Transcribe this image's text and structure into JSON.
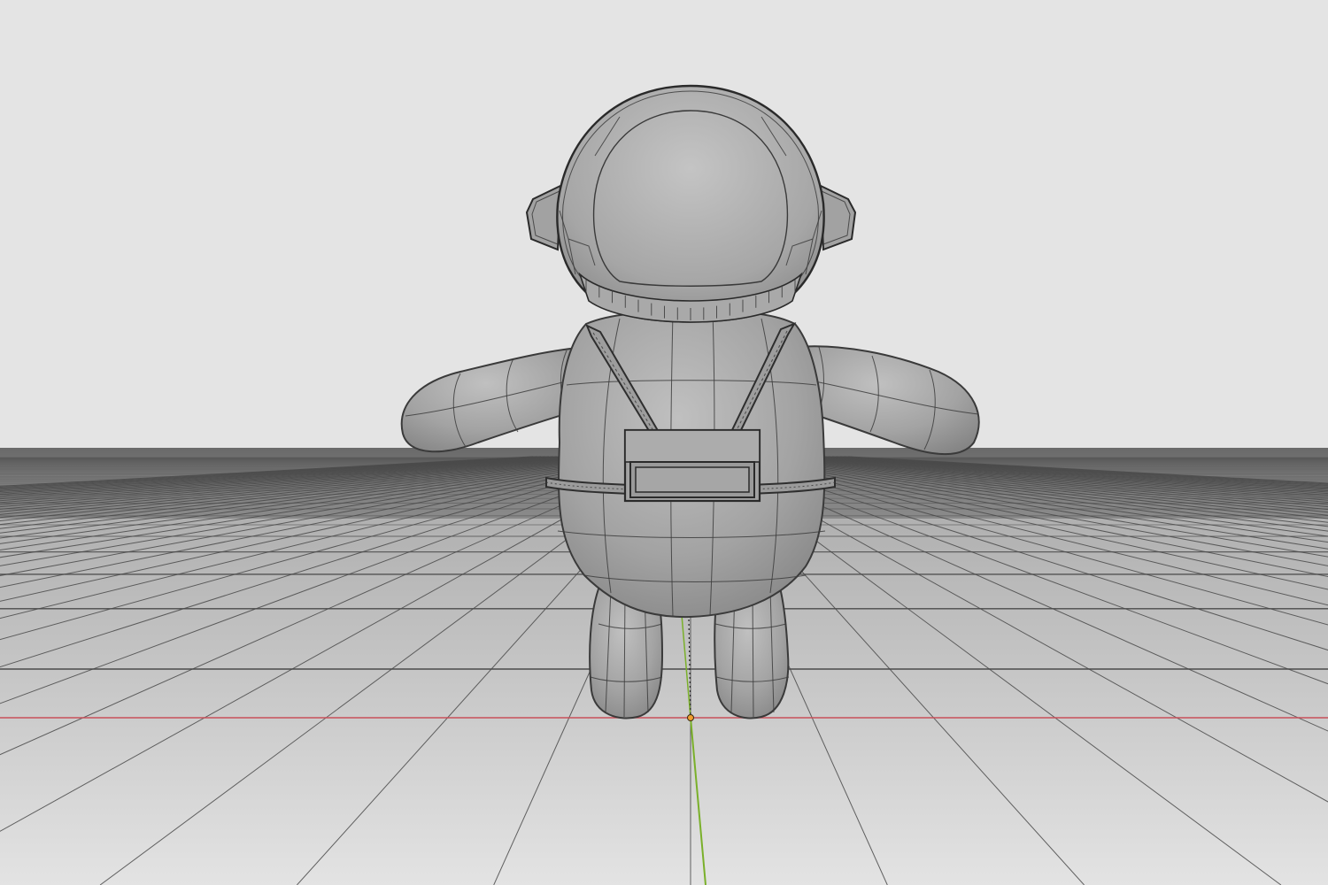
{
  "viewport": {
    "editor": "3D Viewport",
    "shading": "solid-wireframe",
    "background_color": "#e4e4e4",
    "floor_color": "#dcdcdc",
    "grid_line_color": "#4a4a4a",
    "mesh_color": "#a8a8a8",
    "x_axis_color": "#c8505a",
    "y_axis_color": "#7ab02a"
  },
  "scene": {
    "object": "astronaut-character",
    "parts": [
      "helmet",
      "ear-pods",
      "visor-rim",
      "torso",
      "backpack",
      "belt",
      "left-arm",
      "right-arm",
      "left-leg",
      "right-leg"
    ],
    "origin_icon": "origin-marker-icon"
  }
}
